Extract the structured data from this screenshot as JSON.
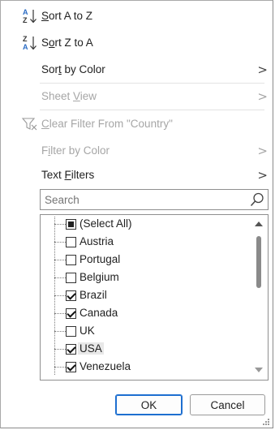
{
  "menu": {
    "sort_az": "Sort A to Z",
    "sort_za": "Sort Z to A",
    "sort_by_color": "Sort by Color",
    "sheet_view": "Sheet View",
    "clear_filter": "Clear Filter From \"Country\"",
    "filter_by_color": "Filter by Color",
    "text_filters": "Text Filters",
    "chevron": ">"
  },
  "search": {
    "placeholder": "Search"
  },
  "list": {
    "items": [
      {
        "label": "(Select All)",
        "state": "indeterminate"
      },
      {
        "label": "Austria",
        "state": "unchecked"
      },
      {
        "label": "Portugal",
        "state": "unchecked"
      },
      {
        "label": "Belgium",
        "state": "unchecked"
      },
      {
        "label": "Brazil",
        "state": "checked"
      },
      {
        "label": "Canada",
        "state": "checked"
      },
      {
        "label": "UK",
        "state": "unchecked"
      },
      {
        "label": "USA",
        "state": "checked"
      },
      {
        "label": "Venezuela",
        "state": "checked"
      }
    ]
  },
  "buttons": {
    "ok": "OK",
    "cancel": "Cancel"
  },
  "colors": {
    "accent": "#1e6fd0",
    "sort_icon_blue": "#2b6cc4",
    "disabled_text": "#a6a6a6"
  },
  "icons": {
    "sort_az": "sort-ascending-icon",
    "sort_za": "sort-descending-icon",
    "clear_filter": "clear-filter-icon",
    "search": "search-icon"
  }
}
